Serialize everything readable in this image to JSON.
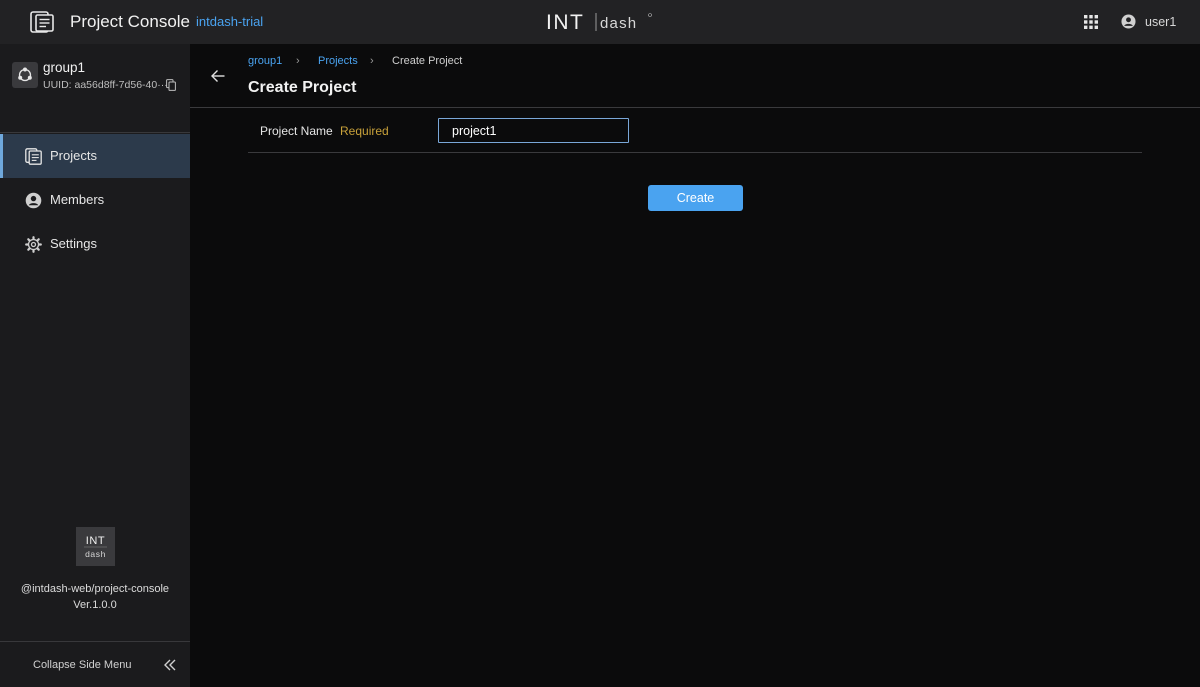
{
  "header": {
    "app_title": "Project Console",
    "environment": "intdash-trial",
    "brand": "INT|dash",
    "user_name": "user1",
    "icons": {
      "app": "document-console-icon",
      "apps": "apps-grid-icon",
      "user": "user-avatar-icon"
    }
  },
  "sidebar": {
    "group": {
      "name": "group1",
      "uuid": "UUID: aa56d8ff-7d56-40···",
      "icon": "group-network-icon",
      "copy_icon": "copy-icon"
    },
    "items": [
      {
        "label": "Projects",
        "icon": "projects-icon",
        "active": true
      },
      {
        "label": "Members",
        "icon": "member-icon",
        "active": false
      },
      {
        "label": "Settings",
        "icon": "gear-icon",
        "active": false
      }
    ],
    "footer": {
      "logo": "INT dash",
      "package": "@intdash-web/project-console",
      "version": "Ver.1.0.0",
      "collapse_label": "Collapse Side Menu",
      "collapse_icon": "double-chevron-left-icon"
    }
  },
  "breadcrumb": [
    "group1",
    "Projects",
    "Create Project"
  ],
  "page": {
    "title": "Create Project",
    "back_icon": "arrow-left-icon"
  },
  "form": {
    "field_label": "Project Name",
    "required_label": "Required",
    "field_value": "project1",
    "submit_label": "Create"
  },
  "colors": {
    "accent": "#4aa3f0",
    "required": "#c8a13a",
    "active_nav": "#2c3a4b",
    "background": "#0b0b0c",
    "sidebar": "#1b1b1d",
    "header": "#222224"
  }
}
